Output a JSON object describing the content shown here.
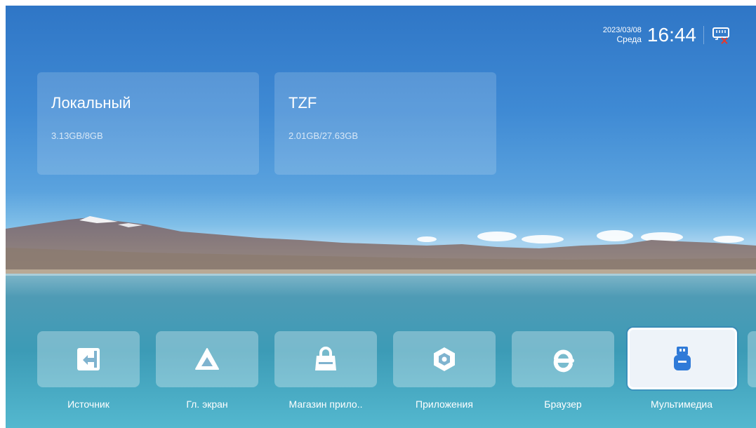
{
  "status": {
    "date": "2023/03/08",
    "weekday": "Среда",
    "time": "16:44",
    "network_icon": "ethernet-disconnected-icon"
  },
  "storage": [
    {
      "name": "Локальный",
      "size": "3.13GB/8GB"
    },
    {
      "name": "TZF",
      "size": "2.01GB/27.63GB"
    }
  ],
  "apps": [
    {
      "label": "Источник",
      "icon": "source-input-icon"
    },
    {
      "label": "Гл. экран",
      "icon": "home-icon"
    },
    {
      "label": "Магазин прило..",
      "icon": "app-store-bag-icon"
    },
    {
      "label": "Приложения",
      "icon": "apps-hexagon-icon"
    },
    {
      "label": "Браузер",
      "icon": "browser-e-icon"
    },
    {
      "label": "Мультимедиа",
      "icon": "multimedia-usb-icon",
      "focused": true
    }
  ],
  "colors": {
    "accent": "#2f7ad8",
    "tile_icon": "#ffffff"
  }
}
